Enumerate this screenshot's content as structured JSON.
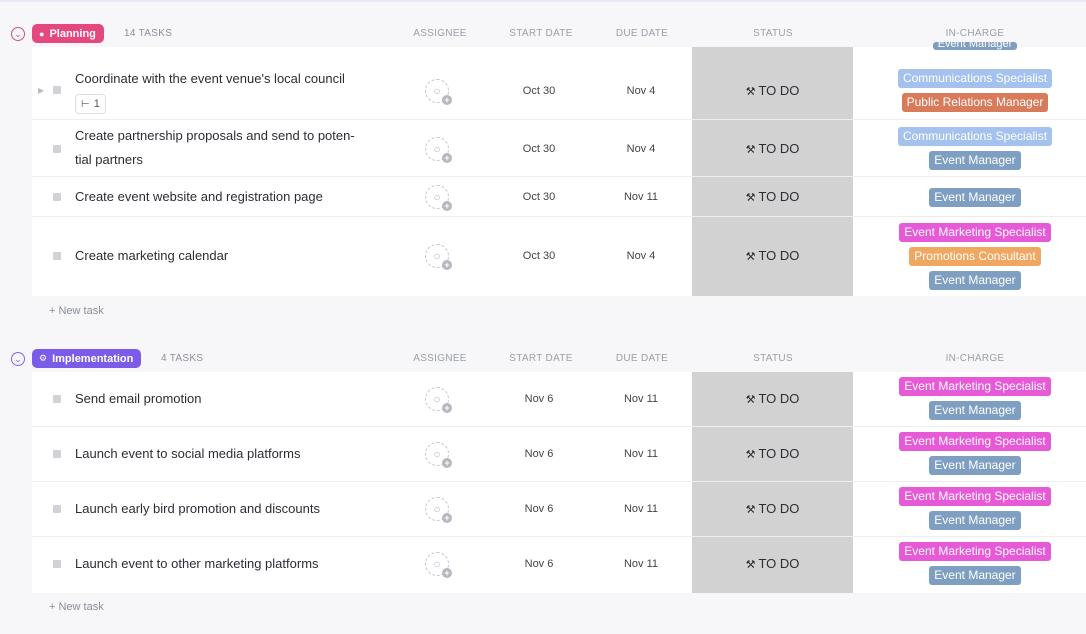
{
  "colors": {
    "planning": "#e5487f",
    "implementation": "#7b5ce8",
    "status_bg": "#d2d2d2",
    "communications": "#8fb3ec",
    "pr": "#d97b5a",
    "event_manager": "#7f9fc2",
    "marketing": "#e65ad8",
    "promotions": "#f0a762"
  },
  "columns": {
    "assignee": "ASSIGNEE",
    "start": "START DATE",
    "due": "DUE DATE",
    "status": "STATUS",
    "incharge": "IN-CHARGE"
  },
  "groups": [
    {
      "name": "Planning",
      "count": "14 TASKS",
      "new_task": "+ New task",
      "cut_tag": "Event Manager",
      "tasks": [
        {
          "name": "Coordinate with the event venue's local council",
          "subtasks": "1",
          "start": "Oct 30",
          "due": "Nov 4",
          "status": "TO DO",
          "tags": [
            "Communications Specialist",
            "Public Relations Manager"
          ]
        },
        {
          "name_line1": "Create partnership proposals and send to poten-",
          "name_line2": "tial partners",
          "start": "Oct 30",
          "due": "Nov 4",
          "status": "TO DO",
          "tags": [
            "Communications Specialist",
            "Event Manager"
          ]
        },
        {
          "name": "Create event website and registration page",
          "start": "Oct 30",
          "due": "Nov 11",
          "status": "TO DO",
          "tags": [
            "Event Manager"
          ]
        },
        {
          "name": "Create marketing calendar",
          "start": "Oct 30",
          "due": "Nov 4",
          "status": "TO DO",
          "tags": [
            "Event Marketing Specialist",
            "Promotions Consultant",
            "Event Manager"
          ]
        }
      ]
    },
    {
      "name": "Implementation",
      "count": "4 TASKS",
      "new_task": "+ New task",
      "tasks": [
        {
          "name": "Send email promotion",
          "start": "Nov 6",
          "due": "Nov 11",
          "status": "TO DO",
          "tags": [
            "Event Marketing Specialist",
            "Event Manager"
          ]
        },
        {
          "name": "Launch event to social media platforms",
          "start": "Nov 6",
          "due": "Nov 11",
          "status": "TO DO",
          "tags": [
            "Event Marketing Specialist",
            "Event Manager"
          ]
        },
        {
          "name": "Launch early bird promotion and discounts",
          "start": "Nov 6",
          "due": "Nov 11",
          "status": "TO DO",
          "tags": [
            "Event Marketing Specialist",
            "Event Manager"
          ]
        },
        {
          "name": "Launch event to other marketing platforms",
          "start": "Nov 6",
          "due": "Nov 11",
          "status": "TO DO",
          "tags": [
            "Event Marketing Specialist",
            "Event Manager"
          ]
        }
      ]
    }
  ]
}
